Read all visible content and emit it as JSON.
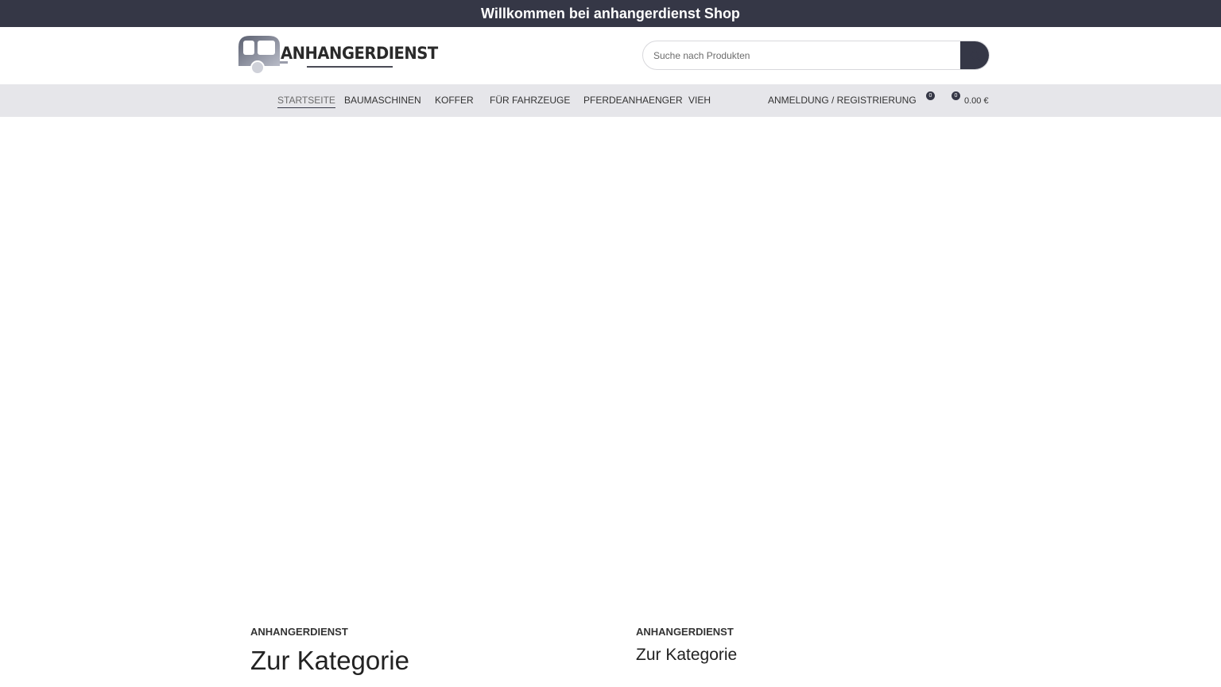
{
  "topbar": {
    "welcome": "Willkommen bei anhangerdienst Shop"
  },
  "header": {
    "logo_text": "ANHANGERDIENST",
    "search": {
      "placeholder": "Suche nach Produkten",
      "value": ""
    }
  },
  "nav": {
    "items": [
      {
        "label": "STARTSEITE",
        "active": true
      },
      {
        "label": "BAUMASCHINEN",
        "active": false
      },
      {
        "label": "KOFFER",
        "active": false
      },
      {
        "label": "FÜR FAHRZEUGE",
        "active": false
      },
      {
        "label": "PFERDEANHAENGER",
        "active": false
      },
      {
        "label": "VIEH",
        "active": false
      }
    ],
    "login": "ANMELDUNG / REGISTRIERUNG",
    "wishlist_count": "0",
    "cart_count": "0",
    "cart_total": "0.00 €"
  },
  "content": {
    "left": {
      "label": "ANHANGERDIENST",
      "heading": "Zur Kategorie"
    },
    "right": {
      "label": "ANHANGERDIENST",
      "heading": "Zur Kategorie"
    }
  },
  "colors": {
    "dark": "#353746",
    "nav_bg": "#e6e6ea"
  }
}
